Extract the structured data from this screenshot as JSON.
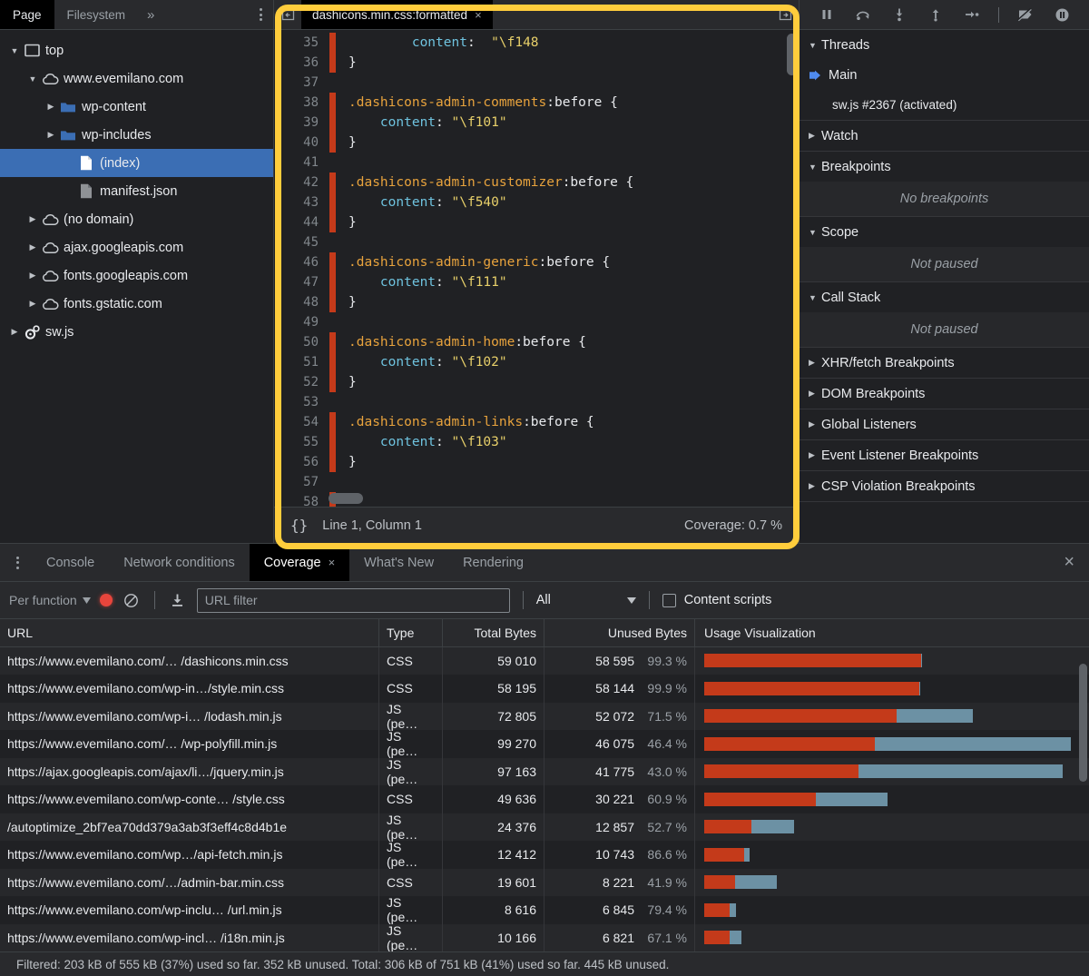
{
  "navigator": {
    "tabs": [
      {
        "label": "Page",
        "active": true
      },
      {
        "label": "Filesystem",
        "active": false
      }
    ],
    "more_label": "»",
    "tree": [
      {
        "label": "top",
        "icon": "frame-icon",
        "depth": 0,
        "twisty": "open",
        "selected": false
      },
      {
        "label": "www.evemilano.com",
        "icon": "cloud-icon",
        "depth": 1,
        "twisty": "open",
        "selected": false
      },
      {
        "label": "wp-content",
        "icon": "folder-icon",
        "depth": 2,
        "twisty": "closed",
        "selected": false
      },
      {
        "label": "wp-includes",
        "icon": "folder-icon",
        "depth": 2,
        "twisty": "closed",
        "selected": false
      },
      {
        "label": "(index)",
        "icon": "document-icon",
        "depth": 3,
        "twisty": "none",
        "selected": true
      },
      {
        "label": "manifest.json",
        "icon": "document-gray-icon",
        "depth": 3,
        "twisty": "none",
        "selected": false
      },
      {
        "label": "(no domain)",
        "icon": "cloud-icon",
        "depth": 1,
        "twisty": "closed",
        "selected": false
      },
      {
        "label": "ajax.googleapis.com",
        "icon": "cloud-icon",
        "depth": 1,
        "twisty": "closed",
        "selected": false
      },
      {
        "label": "fonts.googleapis.com",
        "icon": "cloud-icon",
        "depth": 1,
        "twisty": "closed",
        "selected": false
      },
      {
        "label": "fonts.gstatic.com",
        "icon": "cloud-icon",
        "depth": 1,
        "twisty": "closed",
        "selected": false
      },
      {
        "label": "sw.js",
        "icon": "gears-icon",
        "depth": 0,
        "twisty": "closed",
        "selected": false
      }
    ]
  },
  "sources": {
    "tab_label": "dashicons.min.css:formatted",
    "tab_close": "×",
    "lines": [
      {
        "num": "35",
        "covered": false,
        "unused": true,
        "tokens": [
          {
            "t": "        ",
            "c": "punc"
          },
          {
            "t": "content",
            "c": "prop"
          },
          {
            "t": ":  ",
            "c": "punc"
          },
          {
            "t": "\"\\f148",
            "c": "str"
          }
        ]
      },
      {
        "num": "36",
        "covered": false,
        "unused": true,
        "tokens": [
          {
            "t": "}",
            "c": "brace"
          }
        ]
      },
      {
        "num": "37",
        "covered": false,
        "unused": false,
        "tokens": []
      },
      {
        "num": "38",
        "covered": false,
        "unused": true,
        "tokens": [
          {
            "t": ".dashicons-admin-comments",
            "c": "sel"
          },
          {
            "t": ":before",
            "c": "pseudo"
          },
          {
            "t": " {",
            "c": "brace"
          }
        ]
      },
      {
        "num": "39",
        "covered": false,
        "unused": true,
        "tokens": [
          {
            "t": "    ",
            "c": "punc"
          },
          {
            "t": "content",
            "c": "prop"
          },
          {
            "t": ": ",
            "c": "punc"
          },
          {
            "t": "\"\\f101\"",
            "c": "str"
          }
        ]
      },
      {
        "num": "40",
        "covered": false,
        "unused": true,
        "tokens": [
          {
            "t": "}",
            "c": "brace"
          }
        ]
      },
      {
        "num": "41",
        "covered": false,
        "unused": false,
        "tokens": []
      },
      {
        "num": "42",
        "covered": false,
        "unused": true,
        "tokens": [
          {
            "t": ".dashicons-admin-customizer",
            "c": "sel"
          },
          {
            "t": ":before",
            "c": "pseudo"
          },
          {
            "t": " {",
            "c": "brace"
          }
        ]
      },
      {
        "num": "43",
        "covered": false,
        "unused": true,
        "tokens": [
          {
            "t": "    ",
            "c": "punc"
          },
          {
            "t": "content",
            "c": "prop"
          },
          {
            "t": ": ",
            "c": "punc"
          },
          {
            "t": "\"\\f540\"",
            "c": "str"
          }
        ]
      },
      {
        "num": "44",
        "covered": false,
        "unused": true,
        "tokens": [
          {
            "t": "}",
            "c": "brace"
          }
        ]
      },
      {
        "num": "45",
        "covered": false,
        "unused": false,
        "tokens": []
      },
      {
        "num": "46",
        "covered": false,
        "unused": true,
        "tokens": [
          {
            "t": ".dashicons-admin-generic",
            "c": "sel"
          },
          {
            "t": ":before",
            "c": "pseudo"
          },
          {
            "t": " {",
            "c": "brace"
          }
        ]
      },
      {
        "num": "47",
        "covered": false,
        "unused": true,
        "tokens": [
          {
            "t": "    ",
            "c": "punc"
          },
          {
            "t": "content",
            "c": "prop"
          },
          {
            "t": ": ",
            "c": "punc"
          },
          {
            "t": "\"\\f111\"",
            "c": "str"
          }
        ]
      },
      {
        "num": "48",
        "covered": false,
        "unused": true,
        "tokens": [
          {
            "t": "}",
            "c": "brace"
          }
        ]
      },
      {
        "num": "49",
        "covered": false,
        "unused": false,
        "tokens": []
      },
      {
        "num": "50",
        "covered": false,
        "unused": true,
        "tokens": [
          {
            "t": ".dashicons-admin-home",
            "c": "sel"
          },
          {
            "t": ":before",
            "c": "pseudo"
          },
          {
            "t": " {",
            "c": "brace"
          }
        ]
      },
      {
        "num": "51",
        "covered": false,
        "unused": true,
        "tokens": [
          {
            "t": "    ",
            "c": "punc"
          },
          {
            "t": "content",
            "c": "prop"
          },
          {
            "t": ": ",
            "c": "punc"
          },
          {
            "t": "\"\\f102\"",
            "c": "str"
          }
        ]
      },
      {
        "num": "52",
        "covered": false,
        "unused": true,
        "tokens": [
          {
            "t": "}",
            "c": "brace"
          }
        ]
      },
      {
        "num": "53",
        "covered": false,
        "unused": false,
        "tokens": []
      },
      {
        "num": "54",
        "covered": false,
        "unused": true,
        "tokens": [
          {
            "t": ".dashicons-admin-links",
            "c": "sel"
          },
          {
            "t": ":before",
            "c": "pseudo"
          },
          {
            "t": " {",
            "c": "brace"
          }
        ]
      },
      {
        "num": "55",
        "covered": false,
        "unused": true,
        "tokens": [
          {
            "t": "    ",
            "c": "punc"
          },
          {
            "t": "content",
            "c": "prop"
          },
          {
            "t": ": ",
            "c": "punc"
          },
          {
            "t": "\"\\f103\"",
            "c": "str"
          }
        ]
      },
      {
        "num": "56",
        "covered": false,
        "unused": true,
        "tokens": [
          {
            "t": "}",
            "c": "brace"
          }
        ]
      },
      {
        "num": "57",
        "covered": false,
        "unused": false,
        "tokens": []
      },
      {
        "num": "58",
        "covered": false,
        "unused": true,
        "tokens": []
      }
    ],
    "status": {
      "pretty_print": "{}",
      "cursor": "Line 1, Column 1",
      "coverage": "Coverage: 0.7 %"
    }
  },
  "debugger": {
    "toolbar": [
      {
        "name": "pause-script-execution-button"
      },
      {
        "name": "step-over-button"
      },
      {
        "name": "step-into-button"
      },
      {
        "name": "step-out-button"
      },
      {
        "name": "step-button"
      },
      {
        "name": "deactivate-breakpoints-button"
      },
      {
        "name": "pause-on-exceptions-button"
      }
    ],
    "sections": [
      {
        "title": "Threads",
        "expanded": true,
        "kind": "threads",
        "threads": [
          {
            "label": "Main",
            "selected": true
          },
          {
            "label": "sw.js #2367 (activated)",
            "selected": false
          }
        ]
      },
      {
        "title": "Watch",
        "expanded": false,
        "kind": "plain"
      },
      {
        "title": "Breakpoints",
        "expanded": true,
        "kind": "empty",
        "empty_text": "No breakpoints"
      },
      {
        "title": "Scope",
        "expanded": true,
        "kind": "empty",
        "empty_text": "Not paused"
      },
      {
        "title": "Call Stack",
        "expanded": true,
        "kind": "empty",
        "empty_text": "Not paused"
      },
      {
        "title": "XHR/fetch Breakpoints",
        "expanded": false,
        "kind": "plain"
      },
      {
        "title": "DOM Breakpoints",
        "expanded": false,
        "kind": "plain"
      },
      {
        "title": "Global Listeners",
        "expanded": false,
        "kind": "plain"
      },
      {
        "title": "Event Listener Breakpoints",
        "expanded": false,
        "kind": "plain"
      },
      {
        "title": "CSP Violation Breakpoints",
        "expanded": false,
        "kind": "plain"
      }
    ]
  },
  "drawer": {
    "tabs": [
      {
        "label": "Console",
        "active": false,
        "closable": false
      },
      {
        "label": "Network conditions",
        "active": false,
        "closable": false
      },
      {
        "label": "Coverage",
        "active": true,
        "closable": true
      },
      {
        "label": "What's New",
        "active": false,
        "closable": false
      },
      {
        "label": "Rendering",
        "active": false,
        "closable": false
      }
    ],
    "close_label": "×",
    "toolbar": {
      "granularity": "Per function",
      "record_title": "record-button",
      "clear_title": "clear-button",
      "export_title": "export-button",
      "filter_placeholder": "URL filter",
      "filter_value": "",
      "type_filter": "All",
      "content_scripts_label": "Content scripts",
      "content_scripts_checked": false
    },
    "status": "Filtered: 203 kB of 555 kB (37%) used so far. 352 kB unused. Total: 306 kB of 751 kB (41%) used so far. 445 kB unused."
  },
  "chart_data": {
    "type": "table",
    "title": "Coverage",
    "columns": [
      "URL",
      "Type",
      "Total Bytes",
      "Unused Bytes",
      "Usage Visualization"
    ],
    "max_total_bytes": 99270,
    "legend": [
      {
        "name": "Unused Bytes",
        "color": "#c43a1a"
      },
      {
        "name": "Used Bytes",
        "color": "#6c91a4"
      }
    ],
    "rows": [
      {
        "url": "https://www.evemilano.com/… /dashicons.min.css",
        "type": "CSS",
        "total_bytes": "59 010",
        "unused_bytes": "58 595",
        "unused_pct": "99.3 %",
        "total_num": 59010,
        "unused_num": 58595,
        "selected": true
      },
      {
        "url": "https://www.evemilano.com/wp-in…/style.min.css",
        "type": "CSS",
        "total_bytes": "58 195",
        "unused_bytes": "58 144",
        "unused_pct": "99.9 %",
        "total_num": 58195,
        "unused_num": 58144,
        "selected": false
      },
      {
        "url": "https://www.evemilano.com/wp-i… /lodash.min.js",
        "type": "JS (pe…",
        "total_bytes": "72 805",
        "unused_bytes": "52 072",
        "unused_pct": "71.5 %",
        "total_num": 72805,
        "unused_num": 52072,
        "selected": false
      },
      {
        "url": "https://www.evemilano.com/…  /wp-polyfill.min.js",
        "type": "JS (pe…",
        "total_bytes": "99 270",
        "unused_bytes": "46 075",
        "unused_pct": "46.4 %",
        "total_num": 99270,
        "unused_num": 46075,
        "selected": false
      },
      {
        "url": "https://ajax.googleapis.com/ajax/li…/jquery.min.js",
        "type": "JS (pe…",
        "total_bytes": "97 163",
        "unused_bytes": "41 775",
        "unused_pct": "43.0 %",
        "total_num": 97163,
        "unused_num": 41775,
        "selected": false
      },
      {
        "url": "https://www.evemilano.com/wp-conte… /style.css",
        "type": "CSS",
        "total_bytes": "49 636",
        "unused_bytes": "30 221",
        "unused_pct": "60.9 %",
        "total_num": 49636,
        "unused_num": 30221,
        "selected": false
      },
      {
        "url": "/autoptimize_2bf7ea70dd379a3ab3f3eff4c8d4b1e",
        "type": "JS (pe…",
        "total_bytes": "24 376",
        "unused_bytes": "12 857",
        "unused_pct": "52.7 %",
        "total_num": 24376,
        "unused_num": 12857,
        "selected": false
      },
      {
        "url": "https://www.evemilano.com/wp…/api-fetch.min.js",
        "type": "JS (pe…",
        "total_bytes": "12 412",
        "unused_bytes": "10 743",
        "unused_pct": "86.6 %",
        "total_num": 12412,
        "unused_num": 10743,
        "selected": false
      },
      {
        "url": "https://www.evemilano.com/…/admin-bar.min.css",
        "type": "CSS",
        "total_bytes": "19 601",
        "unused_bytes": "8 221",
        "unused_pct": "41.9 %",
        "total_num": 19601,
        "unused_num": 8221,
        "selected": false
      },
      {
        "url": "https://www.evemilano.com/wp-inclu… /url.min.js",
        "type": "JS (pe…",
        "total_bytes": "8 616",
        "unused_bytes": "6 845",
        "unused_pct": "79.4 %",
        "total_num": 8616,
        "unused_num": 6845,
        "selected": false
      },
      {
        "url": "https://www.evemilano.com/wp-incl… /i18n.min.js",
        "type": "JS (pe…",
        "total_bytes": "10 166",
        "unused_bytes": "6 821",
        "unused_pct": "67.1 %",
        "total_num": 10166,
        "unused_num": 6821,
        "selected": false
      }
    ]
  }
}
